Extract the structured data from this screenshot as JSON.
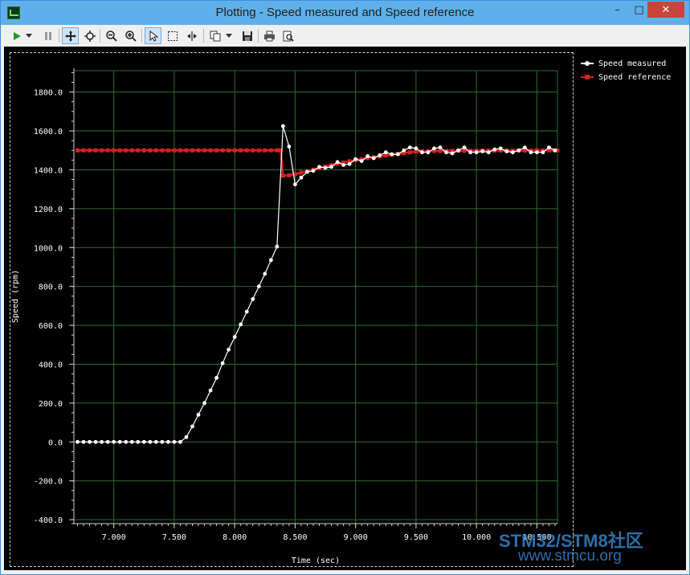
{
  "window": {
    "title": "Plotting  - Speed measured and Speed reference",
    "min_label": "–",
    "max_label": "□",
    "close_label": "✕"
  },
  "toolbar": {
    "icons": [
      "play-icon",
      "dropdown-arrow-icon",
      "pause-icon",
      "pan-icon",
      "zoom-area-icon",
      "zoom-out-icon",
      "zoom-in-icon",
      "select-arrow-icon",
      "select-rectangle-icon",
      "fit-icon",
      "copy-icon",
      "dropdown-arrow-icon",
      "save-icon",
      "print-icon",
      "print-preview-icon"
    ]
  },
  "colors": {
    "background": "#000000",
    "grid": "#2f6b2f",
    "axis": "#cfcfcf",
    "text": "#ffffff",
    "speed_measured": "#ffffff",
    "speed_reference": "#d42020"
  },
  "watermark": {
    "line1": "STM32/STM8社区",
    "line2": "www.stmcu.org"
  },
  "chart_data": {
    "type": "line",
    "title": "",
    "xlabel": "Time (sec)",
    "ylabel": "Speed (rpm)",
    "xlim": [
      6.67,
      10.67
    ],
    "ylim": [
      -420,
      1910
    ],
    "grid": true,
    "legend_position": "right",
    "x_ticks": [
      7.0,
      7.5,
      8.0,
      8.5,
      9.0,
      9.5,
      10.0,
      10.5
    ],
    "x_tick_labels": [
      "7.000",
      "7.500",
      "8.000",
      "8.500",
      "9.000",
      "9.500",
      "10.000",
      "10.500"
    ],
    "y_ticks": [
      -400,
      -200,
      0,
      200,
      400,
      600,
      800,
      1000,
      1200,
      1400,
      1600,
      1800
    ],
    "y_tick_labels": [
      "-400.0",
      "-200.0",
      "0.0",
      "200.0",
      "400.0",
      "600.0",
      "800.0",
      "1000.0",
      "1200.0",
      "1400.0",
      "1600.0",
      "1800.0"
    ],
    "series": [
      {
        "name": "Speed measured",
        "color": "#ffffff",
        "points": [
          [
            6.7,
            0
          ],
          [
            6.75,
            0
          ],
          [
            6.8,
            0
          ],
          [
            6.85,
            0
          ],
          [
            6.9,
            0
          ],
          [
            6.95,
            0
          ],
          [
            7.0,
            0
          ],
          [
            7.05,
            0
          ],
          [
            7.1,
            0
          ],
          [
            7.15,
            0
          ],
          [
            7.2,
            0
          ],
          [
            7.25,
            0
          ],
          [
            7.3,
            0
          ],
          [
            7.35,
            0
          ],
          [
            7.4,
            0
          ],
          [
            7.45,
            0
          ],
          [
            7.5,
            0
          ],
          [
            7.55,
            0
          ],
          [
            7.6,
            25
          ],
          [
            7.65,
            80
          ],
          [
            7.7,
            140
          ],
          [
            7.75,
            200
          ],
          [
            7.8,
            265
          ],
          [
            7.85,
            330
          ],
          [
            7.9,
            405
          ],
          [
            7.95,
            475
          ],
          [
            8.0,
            540
          ],
          [
            8.05,
            605
          ],
          [
            8.1,
            670
          ],
          [
            8.15,
            735
          ],
          [
            8.2,
            800
          ],
          [
            8.25,
            865
          ],
          [
            8.3,
            935
          ],
          [
            8.35,
            1005
          ],
          [
            8.4,
            1625
          ],
          [
            8.45,
            1520
          ],
          [
            8.5,
            1325
          ],
          [
            8.55,
            1360
          ],
          [
            8.6,
            1390
          ],
          [
            8.65,
            1395
          ],
          [
            8.7,
            1415
          ],
          [
            8.75,
            1410
          ],
          [
            8.8,
            1415
          ],
          [
            8.85,
            1440
          ],
          [
            8.9,
            1425
          ],
          [
            8.95,
            1430
          ],
          [
            9.0,
            1455
          ],
          [
            9.05,
            1445
          ],
          [
            9.1,
            1470
          ],
          [
            9.15,
            1460
          ],
          [
            9.2,
            1475
          ],
          [
            9.25,
            1490
          ],
          [
            9.3,
            1480
          ],
          [
            9.35,
            1480
          ],
          [
            9.4,
            1500
          ],
          [
            9.45,
            1515
          ],
          [
            9.5,
            1510
          ],
          [
            9.55,
            1490
          ],
          [
            9.6,
            1490
          ],
          [
            9.65,
            1510
          ],
          [
            9.7,
            1515
          ],
          [
            9.75,
            1490
          ],
          [
            9.8,
            1485
          ],
          [
            9.85,
            1500
          ],
          [
            9.9,
            1515
          ],
          [
            9.95,
            1490
          ],
          [
            10.0,
            1490
          ],
          [
            10.05,
            1495
          ],
          [
            10.1,
            1490
          ],
          [
            10.15,
            1505
          ],
          [
            10.2,
            1510
          ],
          [
            10.25,
            1495
          ],
          [
            10.3,
            1490
          ],
          [
            10.35,
            1500
          ],
          [
            10.4,
            1515
          ],
          [
            10.45,
            1490
          ],
          [
            10.5,
            1490
          ],
          [
            10.55,
            1490
          ],
          [
            10.6,
            1515
          ],
          [
            10.65,
            1500
          ]
        ]
      },
      {
        "name": "Speed reference",
        "color": "#d42020",
        "points": [
          [
            6.7,
            1500
          ],
          [
            6.75,
            1500
          ],
          [
            6.8,
            1500
          ],
          [
            6.85,
            1500
          ],
          [
            6.9,
            1500
          ],
          [
            6.95,
            1500
          ],
          [
            7.0,
            1500
          ],
          [
            7.05,
            1500
          ],
          [
            7.1,
            1500
          ],
          [
            7.15,
            1500
          ],
          [
            7.2,
            1500
          ],
          [
            7.25,
            1500
          ],
          [
            7.3,
            1500
          ],
          [
            7.35,
            1500
          ],
          [
            7.4,
            1500
          ],
          [
            7.45,
            1500
          ],
          [
            7.5,
            1500
          ],
          [
            7.55,
            1500
          ],
          [
            7.6,
            1500
          ],
          [
            7.65,
            1500
          ],
          [
            7.7,
            1500
          ],
          [
            7.75,
            1500
          ],
          [
            7.8,
            1500
          ],
          [
            7.85,
            1500
          ],
          [
            7.9,
            1500
          ],
          [
            7.95,
            1500
          ],
          [
            8.0,
            1500
          ],
          [
            8.05,
            1500
          ],
          [
            8.1,
            1500
          ],
          [
            8.15,
            1500
          ],
          [
            8.2,
            1500
          ],
          [
            8.25,
            1500
          ],
          [
            8.3,
            1500
          ],
          [
            8.35,
            1500
          ],
          [
            8.38,
            1500
          ],
          [
            8.4,
            1370
          ],
          [
            8.45,
            1372
          ],
          [
            8.5,
            1378
          ],
          [
            8.55,
            1385
          ],
          [
            8.6,
            1393
          ],
          [
            8.65,
            1401
          ],
          [
            8.7,
            1409
          ],
          [
            8.75,
            1417
          ],
          [
            8.8,
            1424
          ],
          [
            8.85,
            1431
          ],
          [
            8.9,
            1438
          ],
          [
            8.95,
            1444
          ],
          [
            9.0,
            1450
          ],
          [
            9.05,
            1455
          ],
          [
            9.1,
            1460
          ],
          [
            9.15,
            1465
          ],
          [
            9.2,
            1470
          ],
          [
            9.25,
            1474
          ],
          [
            9.3,
            1478
          ],
          [
            9.35,
            1482
          ],
          [
            9.4,
            1486
          ],
          [
            9.45,
            1490
          ],
          [
            9.5,
            1493
          ],
          [
            9.55,
            1495
          ],
          [
            9.6,
            1496
          ],
          [
            9.65,
            1497
          ],
          [
            9.7,
            1497
          ],
          [
            9.75,
            1497
          ],
          [
            9.8,
            1498
          ],
          [
            9.85,
            1498
          ],
          [
            9.9,
            1498
          ],
          [
            9.95,
            1498
          ],
          [
            10.0,
            1498
          ],
          [
            10.05,
            1499
          ],
          [
            10.1,
            1499
          ],
          [
            10.15,
            1499
          ],
          [
            10.2,
            1499
          ],
          [
            10.25,
            1499
          ],
          [
            10.3,
            1499
          ],
          [
            10.35,
            1499
          ],
          [
            10.4,
            1499
          ],
          [
            10.45,
            1499
          ],
          [
            10.5,
            1500
          ],
          [
            10.55,
            1500
          ],
          [
            10.6,
            1500
          ],
          [
            10.65,
            1500
          ],
          [
            10.67,
            1500
          ]
        ]
      }
    ]
  }
}
